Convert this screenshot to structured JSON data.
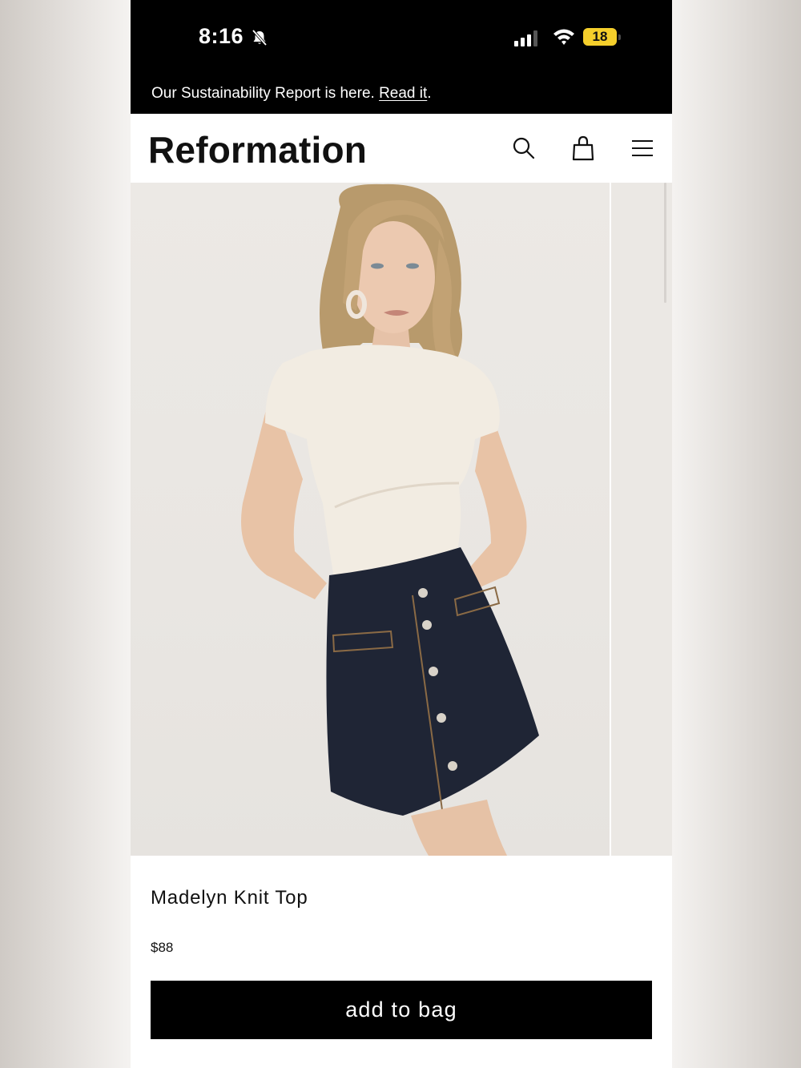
{
  "status_bar": {
    "time": "8:16",
    "battery": "18",
    "battery_level": 0.18
  },
  "announcement": {
    "text": "Our Sustainability Report is here. ",
    "link": "Read it",
    "suffix": "."
  },
  "header": {
    "logo": "Reformation",
    "icons": [
      "search-icon",
      "shopping-bag-icon",
      "hamburger-menu-icon"
    ]
  },
  "product": {
    "name": "Madelyn Knit Top",
    "price": "$88",
    "add_to_bag": "add to bag"
  },
  "colors": {
    "brand_black": "#000000",
    "background": "#ffffff",
    "battery_yellow": "#f5cf2b"
  }
}
